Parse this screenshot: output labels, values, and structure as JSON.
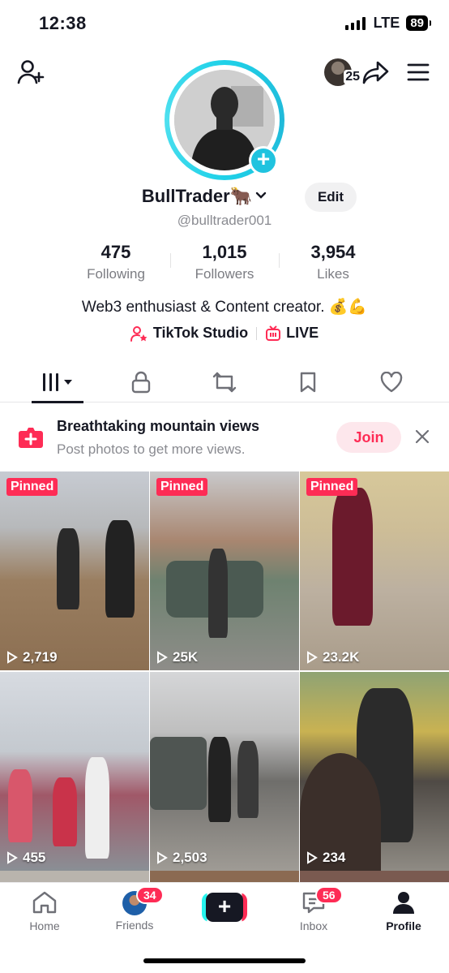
{
  "status_bar": {
    "time": "12:38",
    "network": "LTE",
    "battery": "89"
  },
  "header": {
    "viewer_count": "25"
  },
  "profile": {
    "display_name": "BullTrader🐂",
    "edit_label": "Edit",
    "handle": "@bulltrader001",
    "stats": [
      {
        "value": "475",
        "label": "Following"
      },
      {
        "value": "1,015",
        "label": "Followers"
      },
      {
        "value": "3,954",
        "label": "Likes"
      }
    ],
    "bio": "Web3 enthusiast & Content creator. 💰💪",
    "links": {
      "studio": "TikTok Studio",
      "live": "LIVE"
    }
  },
  "tabs": [
    "videos-grid-icon",
    "lock-icon",
    "repost-icon",
    "bookmark-icon",
    "heart-icon"
  ],
  "promo": {
    "title": "Breathtaking mountain views",
    "subtitle": "Post photos to get more views.",
    "join_label": "Join"
  },
  "videos": [
    {
      "pinned": "Pinned",
      "views": "2,719"
    },
    {
      "pinned": "Pinned",
      "views": "25K"
    },
    {
      "pinned": "Pinned",
      "views": "23.2K"
    },
    {
      "views": "455"
    },
    {
      "views": "2,503"
    },
    {
      "views": "234"
    }
  ],
  "bottom_nav": {
    "home": "Home",
    "friends": "Friends",
    "friends_badge": "34",
    "inbox": "Inbox",
    "inbox_badge": "56",
    "profile": "Profile"
  },
  "colors": {
    "accent": "#fe2c55",
    "ring": "#1fd1e8",
    "text": "#161823",
    "muted": "#8a8b91"
  }
}
